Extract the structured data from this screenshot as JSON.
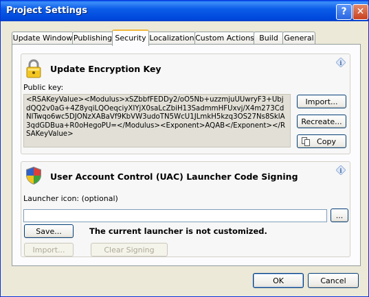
{
  "window": {
    "title": "Project Settings",
    "help_label": "?",
    "close_label": "✕"
  },
  "tabs": [
    {
      "label": "Update Window"
    },
    {
      "label": "Publishing"
    },
    {
      "label": "Security"
    },
    {
      "label": "Localization"
    },
    {
      "label": "Custom Actions"
    },
    {
      "label": "Build"
    },
    {
      "label": "General"
    }
  ],
  "active_tab": "Security",
  "encryption": {
    "title": "Update Encryption Key",
    "public_key_label": "Public key:",
    "public_key_value": "<RSAKeyValue><Modulus>xSZbbfFEDDy2/oO5Nb+uzzmjuUUwryF3+UbjdQQ2v0aG+4Z8yqiLQOeqciyXIYjX0saLcZbiH13SadmmHFUxvj/X4m273CdNlTwqo6wc5DJONzXABaVf9KbVW3udoTN5WcU1JLmkH5kzq3OS27Ns8SklA3qdGDBua+R0oHegoPU=</Modulus><Exponent>AQAB</Exponent></RSAKeyValue>",
    "import_label": "Import...",
    "recreate_label": "Recreate...",
    "copy_label": "Copy"
  },
  "uac": {
    "title": "User Account Control (UAC) Launcher Code Signing",
    "launcher_icon_label": "Launcher icon: (optional)",
    "launcher_icon_value": "",
    "browse_label": "...",
    "save_label": "Save...",
    "status_text": "The current launcher is not customized.",
    "import_label": "Import...",
    "clear_label": "Clear Signing"
  },
  "footer": {
    "ok_label": "OK",
    "cancel_label": "Cancel"
  },
  "colors": {
    "titlebar": "#0a5ef3",
    "dialog_bg": "#ece9d8",
    "active_tab_accent": "#f1b73b"
  }
}
